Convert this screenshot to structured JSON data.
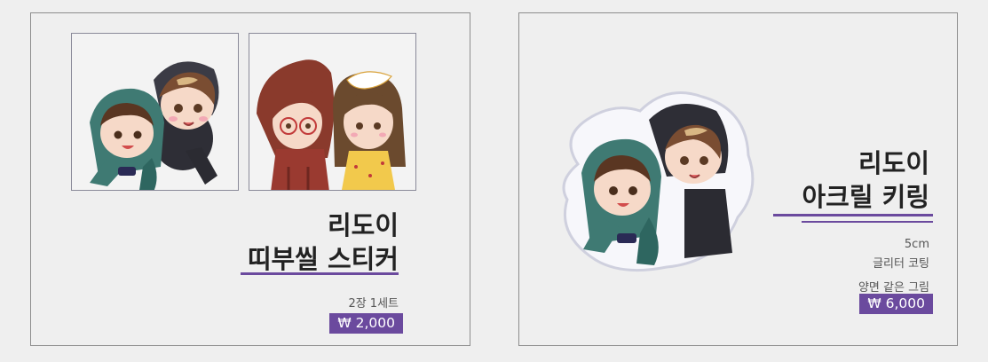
{
  "sticker_product": {
    "title_line1": "리도이",
    "title_line2": "띠부씰 스티커",
    "quantity": "2장 1세트",
    "price": "₩ 2,000"
  },
  "keyring_product": {
    "title_line1": "리도이",
    "title_line2": "아크릴 키링",
    "size": "5cm",
    "coating": "글리터 코팅",
    "print": "양면 같은 그림",
    "price": "₩ 6,000"
  },
  "colors": {
    "accent": "#6b4a9e",
    "border": "#8d8d8d",
    "background": "#efefef"
  }
}
